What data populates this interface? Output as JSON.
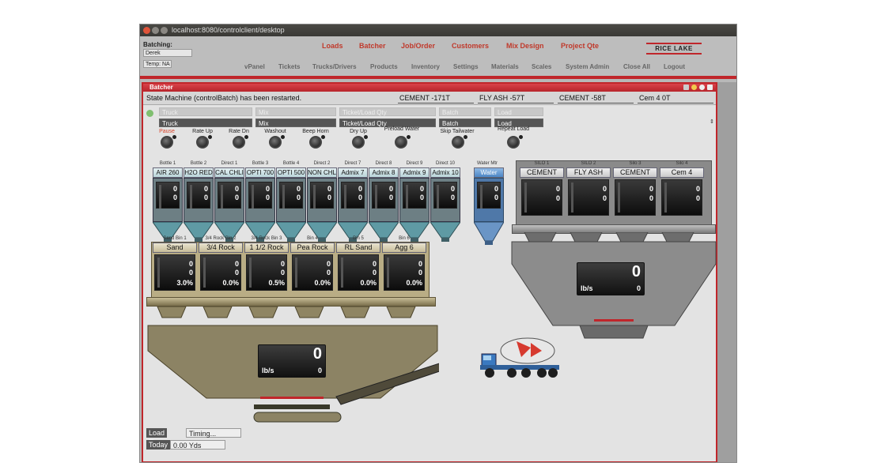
{
  "window": {
    "url": "localhost:8080/controlclient/desktop"
  },
  "appbar": {
    "batching_label": "Batching:",
    "user_field": "Derek",
    "temp_field": "Temp: NA",
    "menu_primary": [
      "Loads",
      "Batcher",
      "Job/Order",
      "Customers",
      "Mix Design",
      "Project Qte"
    ],
    "menu_secondary": [
      "vPanel",
      "Tickets",
      "Trucks/Drivers",
      "Products",
      "Inventory",
      "Settings",
      "Materials",
      "Scales",
      "System Admin",
      "Close All",
      "Logout"
    ],
    "logo": "RICE LAKE",
    "accent": "#c0262b"
  },
  "panel": {
    "title": "Batcher",
    "status": "State Machine (controlBatch) has been restarted.",
    "silo_heads": [
      "CEMENT -171T",
      "FLY ASH -57T",
      "CEMENT -58T",
      "Cem 4 0T"
    ],
    "fields_ghost": [
      "Truck",
      "Mix",
      "Ticket/Load Qty",
      "Batch",
      "Load"
    ],
    "fields": [
      "Truck",
      "Mix",
      "Ticket/Load Qty",
      "Batch",
      "Load"
    ],
    "buttons": [
      "Pause",
      "Rate Up",
      "Rate Dn",
      "Washout",
      "Beep Horn",
      "Dry Up",
      "Preload Water",
      "Skip Tailwater",
      "Repeat Load"
    ],
    "admix": [
      {
        "small": "Bottle 1",
        "name": "AIR 260"
      },
      {
        "small": "Bottle 2",
        "name": "H2O RED"
      },
      {
        "small": "Direct 1",
        "name": "CAL CHLI"
      },
      {
        "small": "Bottle 3",
        "name": "OPTI 700"
      },
      {
        "small": "Bottle 4",
        "name": "OPTI 500"
      },
      {
        "small": "Direct 2",
        "name": "NON CHL"
      },
      {
        "small": "Direct 7",
        "name": "Admix 7"
      },
      {
        "small": "Direct 8",
        "name": "Admix 8"
      },
      {
        "small": "Direct 9",
        "name": "Admix 9"
      },
      {
        "small": "Direct 10",
        "name": "Admix 10"
      }
    ],
    "water": {
      "small": "Water Mtr",
      "name": "Water"
    },
    "silos": [
      {
        "small": "SILO 1",
        "name": "CEMENT"
      },
      {
        "small": "SILO 2",
        "name": "FLY ASH"
      },
      {
        "small": "Silo 3",
        "name": "CEMENT"
      },
      {
        "small": "Silo 4",
        "name": "Cem 4"
      }
    ],
    "bins": [
      {
        "small": "Sand Bin 1",
        "name": "Sand",
        "pct": "3.0%"
      },
      {
        "small": "3/4 Rock Bin 2",
        "name": "3/4 Rock",
        "pct": "0.0%"
      },
      {
        "small": "3/4 Rock Bin 3",
        "name": "1 1/2 Rock",
        "pct": "0.5%"
      },
      {
        "small": "Bin 4",
        "name": "Pea Rock",
        "pct": "0.0%"
      },
      {
        "small": "Bin 5",
        "name": "RL Sand",
        "pct": "0.0%"
      },
      {
        "small": "Bin 6",
        "name": "Agg 6",
        "pct": "0.0%"
      }
    ],
    "zero": "0",
    "cement_scale": {
      "value": "0",
      "unit": "lb/s",
      "rate": "0"
    },
    "agg_scale": {
      "value": "0",
      "unit": "lb/s",
      "rate": "0"
    },
    "load_time": {
      "label": "Load Time",
      "value": "Timing..."
    },
    "today": {
      "label": "Today",
      "value": "0.00 Yds"
    }
  }
}
